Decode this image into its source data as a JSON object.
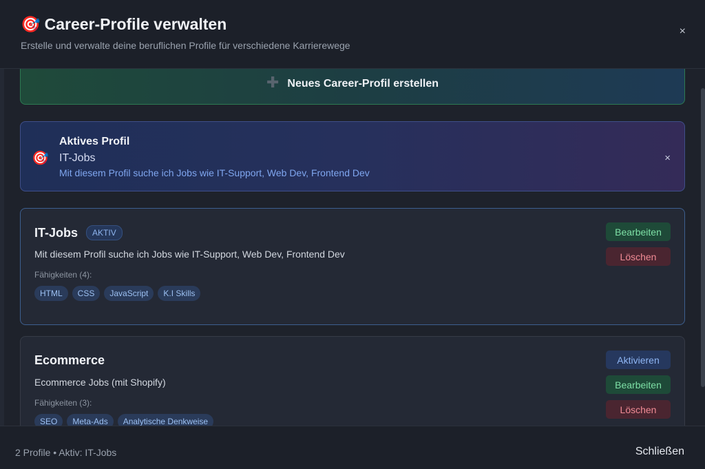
{
  "header": {
    "icon": "🎯",
    "title": "Career-Profile verwalten",
    "subtitle": "Erstelle und verwalte deine beruflichen Profile für verschiedene Karrierewege",
    "close_label": "×"
  },
  "new_profile": {
    "icon": "✚",
    "label": "Neues Career-Profil erstellen"
  },
  "active_profile": {
    "icon": "🎯",
    "heading": "Aktives Profil",
    "name": "IT-Jobs",
    "description": "Mit diesem Profil suche ich Jobs wie IT-Support, Web Dev, Frontend Dev",
    "close_label": "×"
  },
  "profiles": [
    {
      "name": "IT-Jobs",
      "badge": "AKTIV",
      "description": "Mit diesem Profil suche ich Jobs wie IT-Support, Web Dev, Frontend Dev",
      "skills_label": "Fähigkeiten (4):",
      "skills": [
        "HTML",
        "CSS",
        "JavaScript",
        "K.I Skills"
      ],
      "edit_label": "Bearbeiten",
      "delete_label": "Löschen"
    },
    {
      "name": "Ecommerce",
      "description": "Ecommerce Jobs (mit Shopify)",
      "skills_label": "Fähigkeiten (3):",
      "skills": [
        "SEO",
        "Meta-Ads",
        "Analytische Denkweise"
      ],
      "activate_label": "Aktivieren",
      "edit_label": "Bearbeiten",
      "delete_label": "Löschen"
    }
  ],
  "footer": {
    "status": "2 Profile • Aktiv: IT-Jobs",
    "close_label": "Schließen"
  }
}
